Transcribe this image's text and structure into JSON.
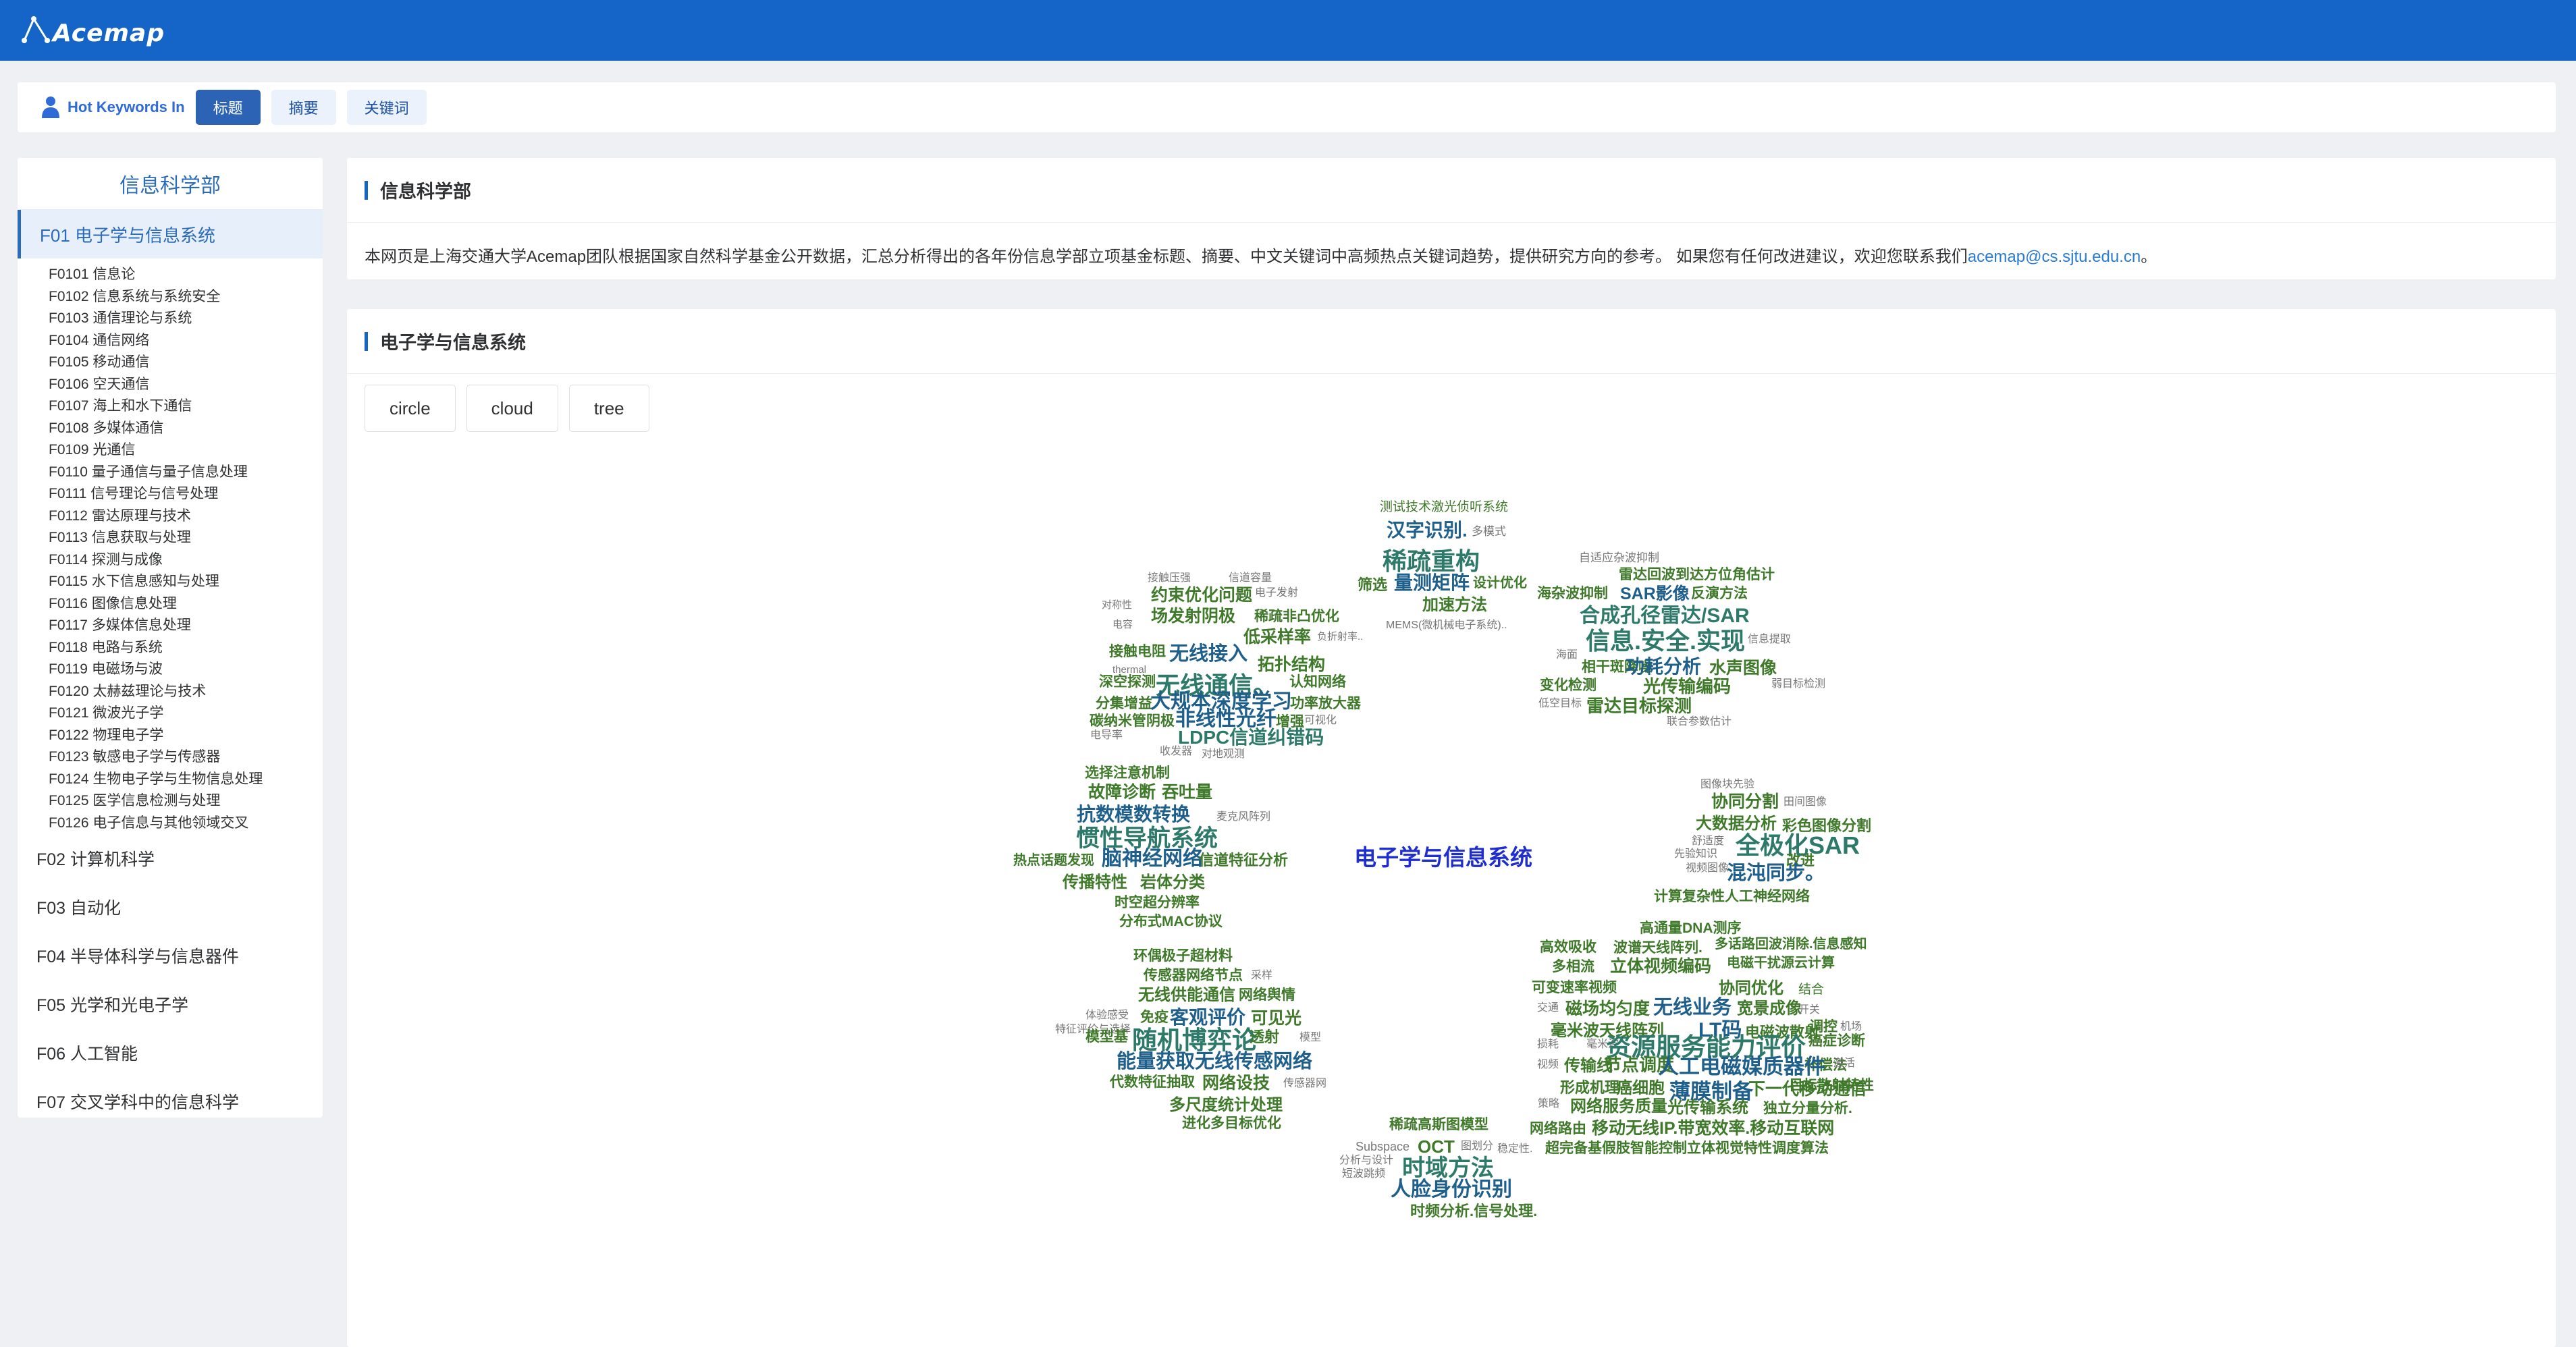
{
  "app": {
    "logo_text": "Acemap"
  },
  "filter_bar": {
    "label": "Hot Keywords In",
    "buttons": [
      {
        "label": "标题",
        "active": true
      },
      {
        "label": "摘要",
        "active": false
      },
      {
        "label": "关键词",
        "active": false
      }
    ]
  },
  "sidebar": {
    "title": "信息科学部",
    "active_item": "F01 电子学与信息系统",
    "sub_items": [
      "F0101 信息论",
      "F0102 信息系统与系统安全",
      "F0103 通信理论与系统",
      "F0104 通信网络",
      "F0105 移动通信",
      "F0106 空天通信",
      "F0107 海上和水下通信",
      "F0108 多媒体通信",
      "F0109 光通信",
      "F0110 量子通信与量子信息处理",
      "F0111 信号理论与信号处理",
      "F0112 雷达原理与技术",
      "F0113 信息获取与处理",
      "F0114 探测与成像",
      "F0115 水下信息感知与处理",
      "F0116 图像信息处理",
      "F0117 多媒体信息处理",
      "F0118 电路与系统",
      "F0119 电磁场与波",
      "F0120 太赫兹理论与技术",
      "F0121 微波光子学",
      "F0122 物理电子学",
      "F0123 敏感电子学与传感器",
      "F0124 生物电子学与生物信息处理",
      "F0125 医学信息检测与处理",
      "F0126 电子信息与其他领域交叉"
    ],
    "top_items": [
      "F02 计算机科学",
      "F03 自动化",
      "F04 半导体科学与信息器件",
      "F05 光学和光电子学",
      "F06 人工智能",
      "F07 交叉学科中的信息科学"
    ]
  },
  "intro_card": {
    "title": "信息科学部",
    "text": "本网页是上海交通大学Acemap团队根据国家自然科学基金公开数据，汇总分析得出的各年份信息学部立项基金标题、摘要、中文关键词中高频热点关键词趋势，提供研究方向的参考。 如果您有任何改进建议，欢迎您联系我们",
    "email": "acemap@cs.sjtu.edu.cn",
    "suffix": "。"
  },
  "chart_card": {
    "title": "电子学与信息系统",
    "view_buttons": [
      "circle",
      "cloud",
      "tree"
    ]
  },
  "wordcloud": {
    "center": "电子学与信息系统",
    "colors": {
      "center": "#1f2fcf",
      "blue": "#1f5f8c",
      "green": "#3f7a2a",
      "teal": "#2e7a6a",
      "gray": "#777777"
    },
    "words": [
      {
        "t": "测试技术激光侦听系统",
        "c": "green"
      },
      {
        "t": "汉字识别.",
        "c": "blue"
      },
      {
        "t": "多模式",
        "c": "gray"
      },
      {
        "t": "稀疏重构",
        "c": "teal"
      },
      {
        "t": "筛选",
        "c": "green"
      },
      {
        "t": "量测矩阵",
        "c": "blue"
      },
      {
        "t": "设计优化",
        "c": "green"
      },
      {
        "t": "加速方法",
        "c": "green"
      },
      {
        "t": "MEMS(微机械电子系统)..",
        "c": "gray"
      },
      {
        "t": "接触压强",
        "c": "gray"
      },
      {
        "t": "信道容量",
        "c": "gray"
      },
      {
        "t": "约束优化问题",
        "c": "green"
      },
      {
        "t": "电子发射",
        "c": "gray"
      },
      {
        "t": "对称性",
        "c": "gray"
      },
      {
        "t": "场发射阴极",
        "c": "green"
      },
      {
        "t": "稀疏非凸优化",
        "c": "green"
      },
      {
        "t": "电容",
        "c": "gray"
      },
      {
        "t": "低采样率",
        "c": "green"
      },
      {
        "t": "负折射率..",
        "c": "gray"
      },
      {
        "t": "接触电阻",
        "c": "green"
      },
      {
        "t": "无线接入",
        "c": "blue"
      },
      {
        "t": "拓扑结构",
        "c": "green"
      },
      {
        "t": "thermal",
        "c": "gray"
      },
      {
        "t": "深空探测",
        "c": "green"
      },
      {
        "t": "无线通信。",
        "c": "teal"
      },
      {
        "t": "认知网络",
        "c": "green"
      },
      {
        "t": "分集增益",
        "c": "green"
      },
      {
        "t": "大规本深度学习",
        "c": "blue"
      },
      {
        "t": "功率放大器",
        "c": "green"
      },
      {
        "t": "碳纳米管阴极",
        "c": "green"
      },
      {
        "t": "非线性光纤",
        "c": "blue"
      },
      {
        "t": "增强",
        "c": "green"
      },
      {
        "t": "可视化",
        "c": "gray"
      },
      {
        "t": "电导率",
        "c": "gray"
      },
      {
        "t": "LDPC信道纠错码",
        "c": "teal"
      },
      {
        "t": "收发器",
        "c": "gray"
      },
      {
        "t": "对地观测",
        "c": "gray"
      },
      {
        "t": "自适应杂波抑制",
        "c": "gray"
      },
      {
        "t": "雷达回波到达方位角估计",
        "c": "green"
      },
      {
        "t": "海杂波抑制",
        "c": "green"
      },
      {
        "t": "SAR影像",
        "c": "blue"
      },
      {
        "t": "反演方法",
        "c": "green"
      },
      {
        "t": "合成孔径雷达/SAR",
        "c": "teal"
      },
      {
        "t": "信息.安全.实现",
        "c": "teal"
      },
      {
        "t": "信息提取",
        "c": "gray"
      },
      {
        "t": "海面",
        "c": "gray"
      },
      {
        "t": "相干斑降噪",
        "c": "green"
      },
      {
        "t": "功耗分析",
        "c": "blue"
      },
      {
        "t": "水声图像",
        "c": "green"
      },
      {
        "t": "弱目标检测",
        "c": "gray"
      },
      {
        "t": "变化检测",
        "c": "green"
      },
      {
        "t": "光传输编码",
        "c": "green"
      },
      {
        "t": "低空目标",
        "c": "gray"
      },
      {
        "t": "雷达目标探测",
        "c": "green"
      },
      {
        "t": "联合参数估计",
        "c": "gray"
      },
      {
        "t": "选择注意机制",
        "c": "green"
      },
      {
        "t": "故障诊断",
        "c": "green"
      },
      {
        "t": "吞吐量",
        "c": "green"
      },
      {
        "t": "抗数模数转换",
        "c": "blue"
      },
      {
        "t": "麦克风阵列",
        "c": "gray"
      },
      {
        "t": "惯性导航系统",
        "c": "teal"
      },
      {
        "t": "热点话题发现",
        "c": "green"
      },
      {
        "t": "脑神经网络",
        "c": "blue"
      },
      {
        "t": "信道特征分析",
        "c": "green"
      },
      {
        "t": "传播特性",
        "c": "green"
      },
      {
        "t": "岩体分类",
        "c": "green"
      },
      {
        "t": "时空超分辨率",
        "c": "green"
      },
      {
        "t": "分布式MAC协议",
        "c": "green"
      },
      {
        "t": "图像块先验",
        "c": "gray"
      },
      {
        "t": "协同分割",
        "c": "green"
      },
      {
        "t": "田间图像",
        "c": "gray"
      },
      {
        "t": "大数据分析",
        "c": "green"
      },
      {
        "t": "彩色图像分割",
        "c": "green"
      },
      {
        "t": "舒适度",
        "c": "gray"
      },
      {
        "t": "全极化SAR",
        "c": "teal"
      },
      {
        "t": "先验知识",
        "c": "gray"
      },
      {
        "t": "改进",
        "c": "green"
      },
      {
        "t": "视频图像",
        "c": "gray"
      },
      {
        "t": "混沌同步。",
        "c": "blue"
      },
      {
        "t": "计算复杂性人工神经网络",
        "c": "green"
      },
      {
        "t": "环偶极子超材料",
        "c": "green"
      },
      {
        "t": "传感器网络节点",
        "c": "green"
      },
      {
        "t": "采样",
        "c": "gray"
      },
      {
        "t": "无线供能通信",
        "c": "green"
      },
      {
        "t": "网络舆情",
        "c": "green"
      },
      {
        "t": "体验感受",
        "c": "gray"
      },
      {
        "t": "免疫",
        "c": "green"
      },
      {
        "t": "客观评价",
        "c": "blue"
      },
      {
        "t": "可见光",
        "c": "green"
      },
      {
        "t": "特征评价与选择",
        "c": "gray"
      },
      {
        "t": "模型基",
        "c": "green"
      },
      {
        "t": "随机博弈论",
        "c": "teal"
      },
      {
        "t": "透射",
        "c": "green"
      },
      {
        "t": "模型",
        "c": "gray"
      },
      {
        "t": "能量获取无线传感网络",
        "c": "blue"
      },
      {
        "t": "代数特征抽取",
        "c": "green"
      },
      {
        "t": "网络设技",
        "c": "green"
      },
      {
        "t": "传感器网",
        "c": "gray"
      },
      {
        "t": "多尺度统计处理",
        "c": "green"
      },
      {
        "t": "进化多目标优化",
        "c": "green"
      },
      {
        "t": "高通量DNA测序",
        "c": "green"
      },
      {
        "t": "高效吸收",
        "c": "green"
      },
      {
        "t": "波谱天线阵列.",
        "c": "green"
      },
      {
        "t": "多话路回波消除.信息感知",
        "c": "green"
      },
      {
        "t": "多相流",
        "c": "green"
      },
      {
        "t": "立体视频编码",
        "c": "green"
      },
      {
        "t": "电磁干扰源云计算",
        "c": "green"
      },
      {
        "t": "可变速率视频",
        "c": "green"
      },
      {
        "t": "协同优化",
        "c": "green"
      },
      {
        "t": "结合",
        "c": "green"
      },
      {
        "t": "交通",
        "c": "gray"
      },
      {
        "t": "磁场均匀度",
        "c": "green"
      },
      {
        "t": "无线业务",
        "c": "blue"
      },
      {
        "t": "宽景成像",
        "c": "green"
      },
      {
        "t": "开关",
        "c": "gray"
      },
      {
        "t": "调控",
        "c": "green"
      },
      {
        "t": "机场",
        "c": "gray"
      },
      {
        "t": "毫米波天线阵列",
        "c": "green"
      },
      {
        "t": "LT码",
        "c": "blue"
      },
      {
        "t": "电磁波散射",
        "c": "green"
      },
      {
        "t": "癌症诊断",
        "c": "green"
      },
      {
        "t": "损耗",
        "c": "gray"
      },
      {
        "t": "毫米波",
        "c": "gray"
      },
      {
        "t": "资源服务能力评价",
        "c": "teal"
      },
      {
        "t": "补偿法",
        "c": "green"
      },
      {
        "t": "激活",
        "c": "gray"
      },
      {
        "t": "视频",
        "c": "gray"
      },
      {
        "t": "传输线",
        "c": "green"
      },
      {
        "t": "节点调度",
        "c": "green"
      },
      {
        "t": "人工电磁媒质器件",
        "c": "blue"
      },
      {
        "t": "目标散射特性",
        "c": "green"
      },
      {
        "t": "形成机理",
        "c": "green"
      },
      {
        "t": "癌细胞",
        "c": "green"
      },
      {
        "t": "薄膜制备",
        "c": "blue"
      },
      {
        "t": "下一代移动通信",
        "c": "green"
      },
      {
        "t": "策略",
        "c": "gray"
      },
      {
        "t": "网络服务质量",
        "c": "green"
      },
      {
        "t": "光传输系统",
        "c": "green"
      },
      {
        "t": "独立分量分析.",
        "c": "green"
      },
      {
        "t": "稀疏高斯图模型",
        "c": "green"
      },
      {
        "t": "网络路由",
        "c": "green"
      },
      {
        "t": "移动无线IP.带宽效率.移动互联网",
        "c": "green"
      },
      {
        "t": "Subspace",
        "c": "gray"
      },
      {
        "t": "OCT",
        "c": "green"
      },
      {
        "t": "图划分",
        "c": "gray"
      },
      {
        "t": "稳定性.",
        "c": "gray"
      },
      {
        "t": "超完备基假肢智能控制立体视觉特性调度算法",
        "c": "green"
      },
      {
        "t": "分析与设计",
        "c": "gray"
      },
      {
        "t": "时域方法",
        "c": "teal"
      },
      {
        "t": "短波跳频",
        "c": "gray"
      },
      {
        "t": "人脸身份识别",
        "c": "blue"
      },
      {
        "t": "时频分析.信号处理.",
        "c": "green"
      }
    ]
  }
}
